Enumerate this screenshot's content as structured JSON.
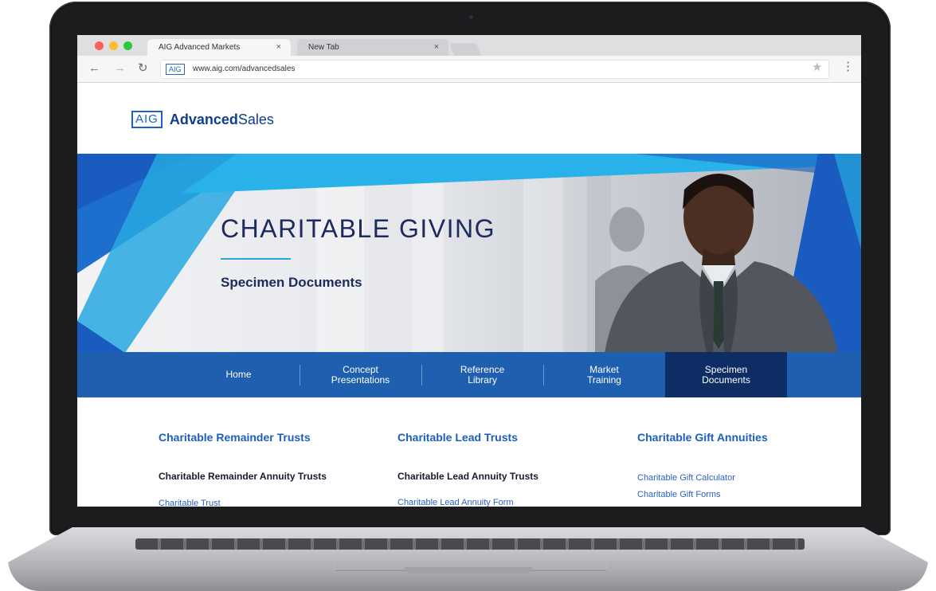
{
  "browser": {
    "tabs": [
      {
        "title": "AIG Advanced Markets",
        "active": true
      },
      {
        "title": "New Tab",
        "active": false
      }
    ],
    "close_glyph": "×",
    "url_badge": "AIG",
    "url": "www.aig.com/advancedsales",
    "icons": [
      "back-icon",
      "forward-icon",
      "reload-icon",
      "star-icon",
      "menu-icon"
    ]
  },
  "logo": {
    "box": "AIG",
    "bold": "Advanced",
    "light": "Sales"
  },
  "hero": {
    "title": "CHARITABLE GIVING",
    "subtitle": "Specimen Documents"
  },
  "nav": {
    "items": [
      {
        "label": "Home",
        "active": false
      },
      {
        "label": "Concept\nPresentations",
        "active": false
      },
      {
        "label": "Reference\nLibrary",
        "active": false
      },
      {
        "label": "Market\nTraining",
        "active": false
      },
      {
        "label": "Specimen\nDocuments",
        "active": true
      }
    ]
  },
  "sections": [
    {
      "heading": "Charitable Remainder Trusts",
      "subheading": "Charitable Remainder Annuity Trusts",
      "links": [
        "Charitable Trust"
      ]
    },
    {
      "heading": "Charitable Lead Trusts",
      "subheading": "Charitable Lead Annuity Trusts",
      "links": [
        "Charitable Lead Annuity Form"
      ]
    },
    {
      "heading": "Charitable Gift Annuities",
      "subheading": "",
      "links": [
        "Charitable Gift Calculator",
        "Charitable Gift Forms"
      ]
    }
  ],
  "colors": {
    "brand_blue": "#1f5fb0",
    "active_nav": "#0d2d64",
    "heading_blue": "#1d5fb8",
    "accent_cyan": "#29a3de"
  }
}
